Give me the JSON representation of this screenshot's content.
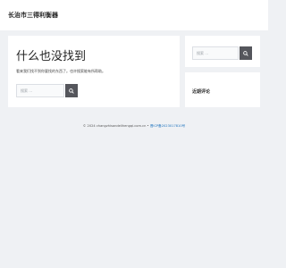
{
  "header": {
    "site_title": "长治市三得利衡器"
  },
  "main": {
    "title": "什么也没找到",
    "message": "看来我们找不到你要找的东西了。也许搜索能有所帮助。",
    "search": {
      "placeholder": "搜索 …"
    }
  },
  "sidebar": {
    "search": {
      "placeholder": "搜索 …"
    },
    "recent_comments": {
      "heading": "近期评论"
    }
  },
  "footer": {
    "copyright": "© 2024 changzhisandelihengqi.com.cn •",
    "icp_link": "晋ICP备2023017810号"
  },
  "icons": {
    "search": "search-icon"
  },
  "colors": {
    "background": "#eff1f4",
    "card": "#ffffff",
    "search_button": "#55565c",
    "link": "#1e73be"
  }
}
